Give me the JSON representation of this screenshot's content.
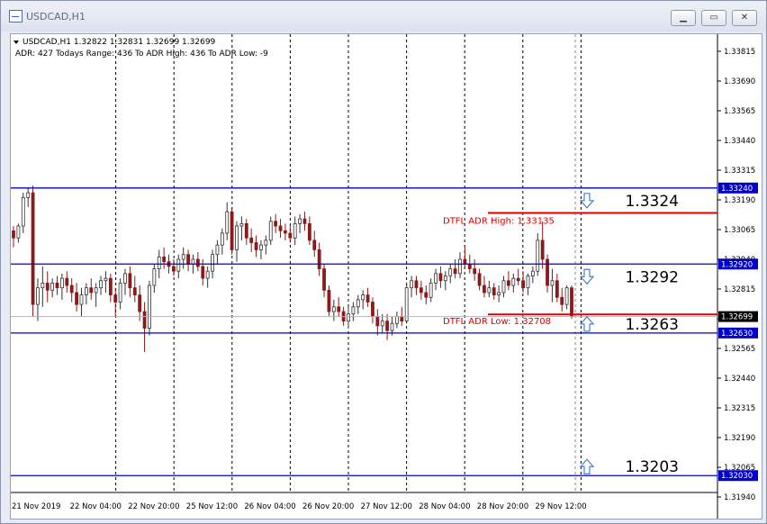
{
  "window": {
    "title": "USDCAD,H1"
  },
  "chart_info": {
    "line1": "USDCAD,H1  1.32822 1.32831 1.32699 1.32699",
    "line2": "ADR: 427  Todays Range: 436  To ADR High: 436  To ADR Low: -9"
  },
  "colors": {
    "level_line": "#0000c8",
    "adr_line": "#e00000",
    "candle_up": "#333333",
    "candle_down": "#8b1a1a",
    "arrow": "#4a7fd0"
  },
  "icons": [
    "chart-app-icon",
    "minimize-icon",
    "maximize-icon",
    "close-icon",
    "arrow-down-icon",
    "arrow-up-icon",
    "info-dropdown-icon"
  ],
  "chart_data": {
    "type": "candlestick",
    "symbol": "USDCAD",
    "timeframe": "H1",
    "ylim": [
      1.3188,
      1.33875
    ],
    "y_ticks": [
      "1.33815",
      "1.33690",
      "1.33565",
      "1.33440",
      "1.33315",
      "1.33190",
      "1.33065",
      "1.32940",
      "1.32815",
      "1.32690",
      "1.32565",
      "1.32440",
      "1.32315",
      "1.32190",
      "1.32065",
      "1.31940"
    ],
    "x_ticks": [
      "21 Nov 2019",
      "22 Nov 04:00",
      "22 Nov 20:00",
      "25 Nov 12:00",
      "26 Nov 04:00",
      "26 Nov 20:00",
      "27 Nov 12:00",
      "28 Nov 04:00",
      "28 Nov 20:00",
      "29 Nov 12:00"
    ],
    "current_price": "1.32699",
    "levels": [
      {
        "price": 1.3324,
        "label": "1.3324",
        "tag": "1.33240",
        "arrow": "down"
      },
      {
        "price": 1.3292,
        "label": "1.3292",
        "tag": "1.32920",
        "arrow": "down"
      },
      {
        "price": 1.3263,
        "label": "1.3263",
        "tag": "1.32630",
        "arrow": "up"
      },
      {
        "price": 1.3203,
        "label": "1.3203",
        "tag": "1.32030",
        "arrow": "up"
      }
    ],
    "adr_high": {
      "price": 1.33135,
      "label": "DTFL ADR High: 1.33135"
    },
    "adr_low": {
      "price": 1.32708,
      "label": "DTFL ADR Low: 1.32708"
    },
    "ohlc": [
      [
        1.3306,
        1.3308,
        1.3299,
        1.3303
      ],
      [
        1.3303,
        1.3309,
        1.3301,
        1.3308
      ],
      [
        1.3308,
        1.3322,
        1.3305,
        1.332
      ],
      [
        1.332,
        1.3324,
        1.3316,
        1.3322
      ],
      [
        1.3322,
        1.3325,
        1.327,
        1.3275
      ],
      [
        1.3275,
        1.3286,
        1.3268,
        1.3282
      ],
      [
        1.3282,
        1.3291,
        1.3274,
        1.3284
      ],
      [
        1.3284,
        1.3289,
        1.3276,
        1.3281
      ],
      [
        1.3281,
        1.3286,
        1.3278,
        1.3284
      ],
      [
        1.3284,
        1.3287,
        1.3279,
        1.3282
      ],
      [
        1.3282,
        1.3288,
        1.3277,
        1.3286
      ],
      [
        1.3286,
        1.3289,
        1.328,
        1.3283
      ],
      [
        1.3283,
        1.3286,
        1.3276,
        1.328
      ],
      [
        1.328,
        1.3284,
        1.3272,
        1.3275
      ],
      [
        1.3275,
        1.3282,
        1.327,
        1.3279
      ],
      [
        1.3279,
        1.3284,
        1.3275,
        1.3282
      ],
      [
        1.3282,
        1.3286,
        1.3277,
        1.328
      ],
      [
        1.328,
        1.3284,
        1.3274,
        1.3282
      ],
      [
        1.3282,
        1.3287,
        1.3279,
        1.3285
      ],
      [
        1.3285,
        1.3289,
        1.328,
        1.3286
      ],
      [
        1.3286,
        1.3288,
        1.3276,
        1.3279
      ],
      [
        1.3279,
        1.3282,
        1.327,
        1.3276
      ],
      [
        1.3276,
        1.3286,
        1.3273,
        1.3284
      ],
      [
        1.3284,
        1.329,
        1.3279,
        1.3288
      ],
      [
        1.3288,
        1.3291,
        1.3278,
        1.3282
      ],
      [
        1.3282,
        1.3287,
        1.3276,
        1.3279
      ],
      [
        1.3279,
        1.3283,
        1.3268,
        1.3272
      ],
      [
        1.3272,
        1.3276,
        1.3255,
        1.3265
      ],
      [
        1.3265,
        1.3285,
        1.3262,
        1.3283
      ],
      [
        1.3283,
        1.3292,
        1.328,
        1.329
      ],
      [
        1.329,
        1.3298,
        1.3286,
        1.3295
      ],
      [
        1.3295,
        1.3299,
        1.329,
        1.3293
      ],
      [
        1.3293,
        1.3296,
        1.3288,
        1.3291
      ],
      [
        1.3291,
        1.3294,
        1.3287,
        1.3289
      ],
      [
        1.3289,
        1.3296,
        1.3286,
        1.3294
      ],
      [
        1.3294,
        1.3299,
        1.329,
        1.3296
      ],
      [
        1.3296,
        1.3298,
        1.3289,
        1.3292
      ],
      [
        1.3292,
        1.3296,
        1.3288,
        1.3294
      ],
      [
        1.3294,
        1.3297,
        1.3289,
        1.3291
      ],
      [
        1.3291,
        1.3294,
        1.3283,
        1.3286
      ],
      [
        1.3286,
        1.3291,
        1.3282,
        1.3289
      ],
      [
        1.3289,
        1.3298,
        1.3286,
        1.3296
      ],
      [
        1.3296,
        1.3302,
        1.3292,
        1.33
      ],
      [
        1.33,
        1.3307,
        1.3296,
        1.3305
      ],
      [
        1.3305,
        1.3318,
        1.3302,
        1.3314
      ],
      [
        1.3314,
        1.3316,
        1.3296,
        1.3298
      ],
      [
        1.3298,
        1.331,
        1.3293,
        1.3308
      ],
      [
        1.3308,
        1.3312,
        1.3302,
        1.3309
      ],
      [
        1.3309,
        1.3311,
        1.33,
        1.3303
      ],
      [
        1.3303,
        1.3307,
        1.3297,
        1.3301
      ],
      [
        1.3301,
        1.3304,
        1.3295,
        1.3298
      ],
      [
        1.3298,
        1.3302,
        1.3294,
        1.33
      ],
      [
        1.33,
        1.3304,
        1.3296,
        1.3302
      ],
      [
        1.3302,
        1.3312,
        1.33,
        1.331
      ],
      [
        1.331,
        1.3313,
        1.3305,
        1.3308
      ],
      [
        1.3308,
        1.3311,
        1.3303,
        1.3306
      ],
      [
        1.3306,
        1.3309,
        1.3302,
        1.3305
      ],
      [
        1.3305,
        1.3308,
        1.3301,
        1.3303
      ],
      [
        1.3303,
        1.3312,
        1.33,
        1.3309
      ],
      [
        1.3309,
        1.3313,
        1.3305,
        1.3311
      ],
      [
        1.3311,
        1.3314,
        1.3306,
        1.3309
      ],
      [
        1.3309,
        1.3312,
        1.33,
        1.3302
      ],
      [
        1.3302,
        1.3306,
        1.3295,
        1.3298
      ],
      [
        1.3298,
        1.3301,
        1.3287,
        1.329
      ],
      [
        1.329,
        1.3292,
        1.3278,
        1.3281
      ],
      [
        1.3281,
        1.3283,
        1.327,
        1.3272
      ],
      [
        1.3272,
        1.3277,
        1.3268,
        1.3274
      ],
      [
        1.3274,
        1.3278,
        1.327,
        1.3272
      ],
      [
        1.3272,
        1.3274,
        1.3266,
        1.3268
      ],
      [
        1.3268,
        1.3274,
        1.3265,
        1.3271
      ],
      [
        1.3271,
        1.3276,
        1.3268,
        1.3274
      ],
      [
        1.3274,
        1.3279,
        1.3271,
        1.3277
      ],
      [
        1.3277,
        1.3281,
        1.3273,
        1.3279
      ],
      [
        1.3279,
        1.3282,
        1.3274,
        1.3276
      ],
      [
        1.3276,
        1.3278,
        1.3267,
        1.327
      ],
      [
        1.327,
        1.3273,
        1.3262,
        1.3266
      ],
      [
        1.3266,
        1.3271,
        1.3263,
        1.3268
      ],
      [
        1.3268,
        1.3271,
        1.326,
        1.3264
      ],
      [
        1.3264,
        1.327,
        1.3262,
        1.3267
      ],
      [
        1.3267,
        1.3272,
        1.3265,
        1.327
      ],
      [
        1.327,
        1.3274,
        1.3266,
        1.3268
      ],
      [
        1.3268,
        1.3284,
        1.3267,
        1.3282
      ],
      [
        1.3282,
        1.3287,
        1.3278,
        1.3285
      ],
      [
        1.3285,
        1.3287,
        1.3279,
        1.3282
      ],
      [
        1.3282,
        1.3285,
        1.3277,
        1.328
      ],
      [
        1.328,
        1.3283,
        1.3275,
        1.3278
      ],
      [
        1.3278,
        1.3286,
        1.3276,
        1.3284
      ],
      [
        1.3284,
        1.329,
        1.3281,
        1.3288
      ],
      [
        1.3288,
        1.3291,
        1.3282,
        1.3285
      ],
      [
        1.3285,
        1.3289,
        1.3281,
        1.3287
      ],
      [
        1.3287,
        1.3292,
        1.3284,
        1.329
      ],
      [
        1.329,
        1.3294,
        1.3286,
        1.3288
      ],
      [
        1.3288,
        1.3297,
        1.3286,
        1.3294
      ],
      [
        1.3294,
        1.33,
        1.329,
        1.3292
      ],
      [
        1.3292,
        1.3296,
        1.3288,
        1.329
      ],
      [
        1.329,
        1.3294,
        1.3285,
        1.3288
      ],
      [
        1.3288,
        1.329,
        1.3281,
        1.3283
      ],
      [
        1.3283,
        1.3287,
        1.3278,
        1.328
      ],
      [
        1.328,
        1.3285,
        1.3278,
        1.3282
      ],
      [
        1.3282,
        1.3284,
        1.3277,
        1.3279
      ],
      [
        1.3279,
        1.3283,
        1.3276,
        1.328
      ],
      [
        1.328,
        1.3287,
        1.3278,
        1.3285
      ],
      [
        1.3285,
        1.3289,
        1.3281,
        1.3283
      ],
      [
        1.3283,
        1.3288,
        1.328,
        1.3286
      ],
      [
        1.3286,
        1.329,
        1.3283,
        1.3285
      ],
      [
        1.3285,
        1.3289,
        1.328,
        1.3282
      ],
      [
        1.3282,
        1.3288,
        1.3279,
        1.3287
      ],
      [
        1.3287,
        1.3291,
        1.3284,
        1.3289
      ],
      [
        1.3289,
        1.3305,
        1.3287,
        1.3302
      ],
      [
        1.3302,
        1.331,
        1.329,
        1.3294
      ],
      [
        1.3294,
        1.3296,
        1.328,
        1.3283
      ],
      [
        1.3283,
        1.329,
        1.3276,
        1.3285
      ],
      [
        1.3285,
        1.3288,
        1.3276,
        1.3278
      ],
      [
        1.3278,
        1.3282,
        1.3272,
        1.3275
      ],
      [
        1.3275,
        1.3283,
        1.3273,
        1.3282
      ],
      [
        1.3282,
        1.3283,
        1.3269,
        1.327
      ]
    ]
  }
}
